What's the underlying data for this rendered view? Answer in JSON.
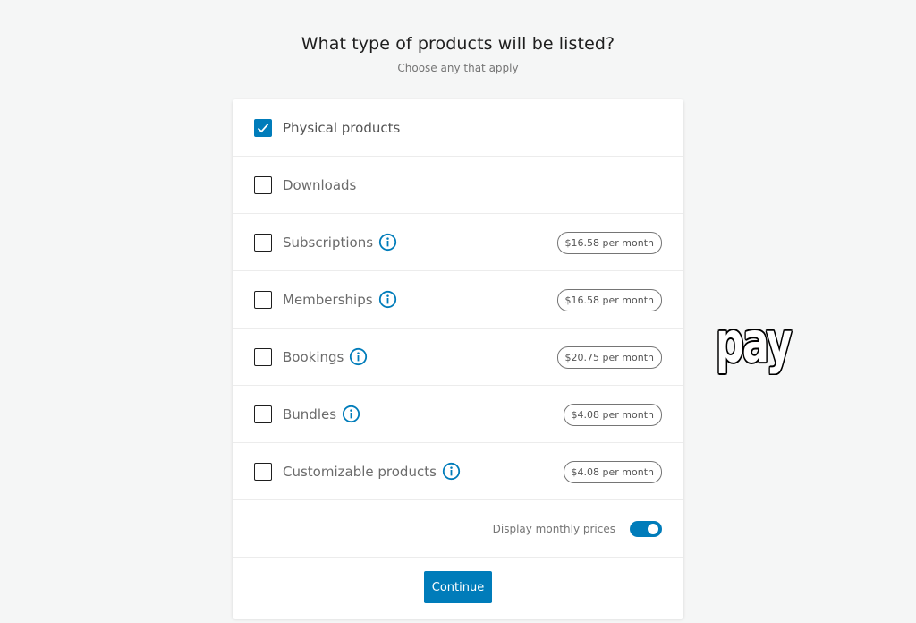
{
  "header": {
    "title": "What type of products will be listed?",
    "subtitle": "Choose any that apply"
  },
  "products": [
    {
      "label": "Physical products",
      "checked": true,
      "info": false,
      "price": ""
    },
    {
      "label": "Downloads",
      "checked": false,
      "info": false,
      "price": ""
    },
    {
      "label": "Subscriptions",
      "checked": false,
      "info": true,
      "price": "$16.58 per month"
    },
    {
      "label": "Memberships",
      "checked": false,
      "info": true,
      "price": "$16.58 per month"
    },
    {
      "label": "Bookings",
      "checked": false,
      "info": true,
      "price": "$20.75 per month"
    },
    {
      "label": "Bundles",
      "checked": false,
      "info": true,
      "price": "$4.08 per month"
    },
    {
      "label": "Customizable products",
      "checked": false,
      "info": true,
      "price": "$4.08 per month"
    }
  ],
  "toggle": {
    "label": "Display monthly prices",
    "on": true
  },
  "footer": {
    "continue_label": "Continue"
  },
  "sticker": {
    "text": "pay"
  },
  "colors": {
    "accent": "#007cba",
    "background": "#f5f6f6"
  },
  "icons": {
    "check": "checkmark-icon",
    "info": "info-icon"
  }
}
